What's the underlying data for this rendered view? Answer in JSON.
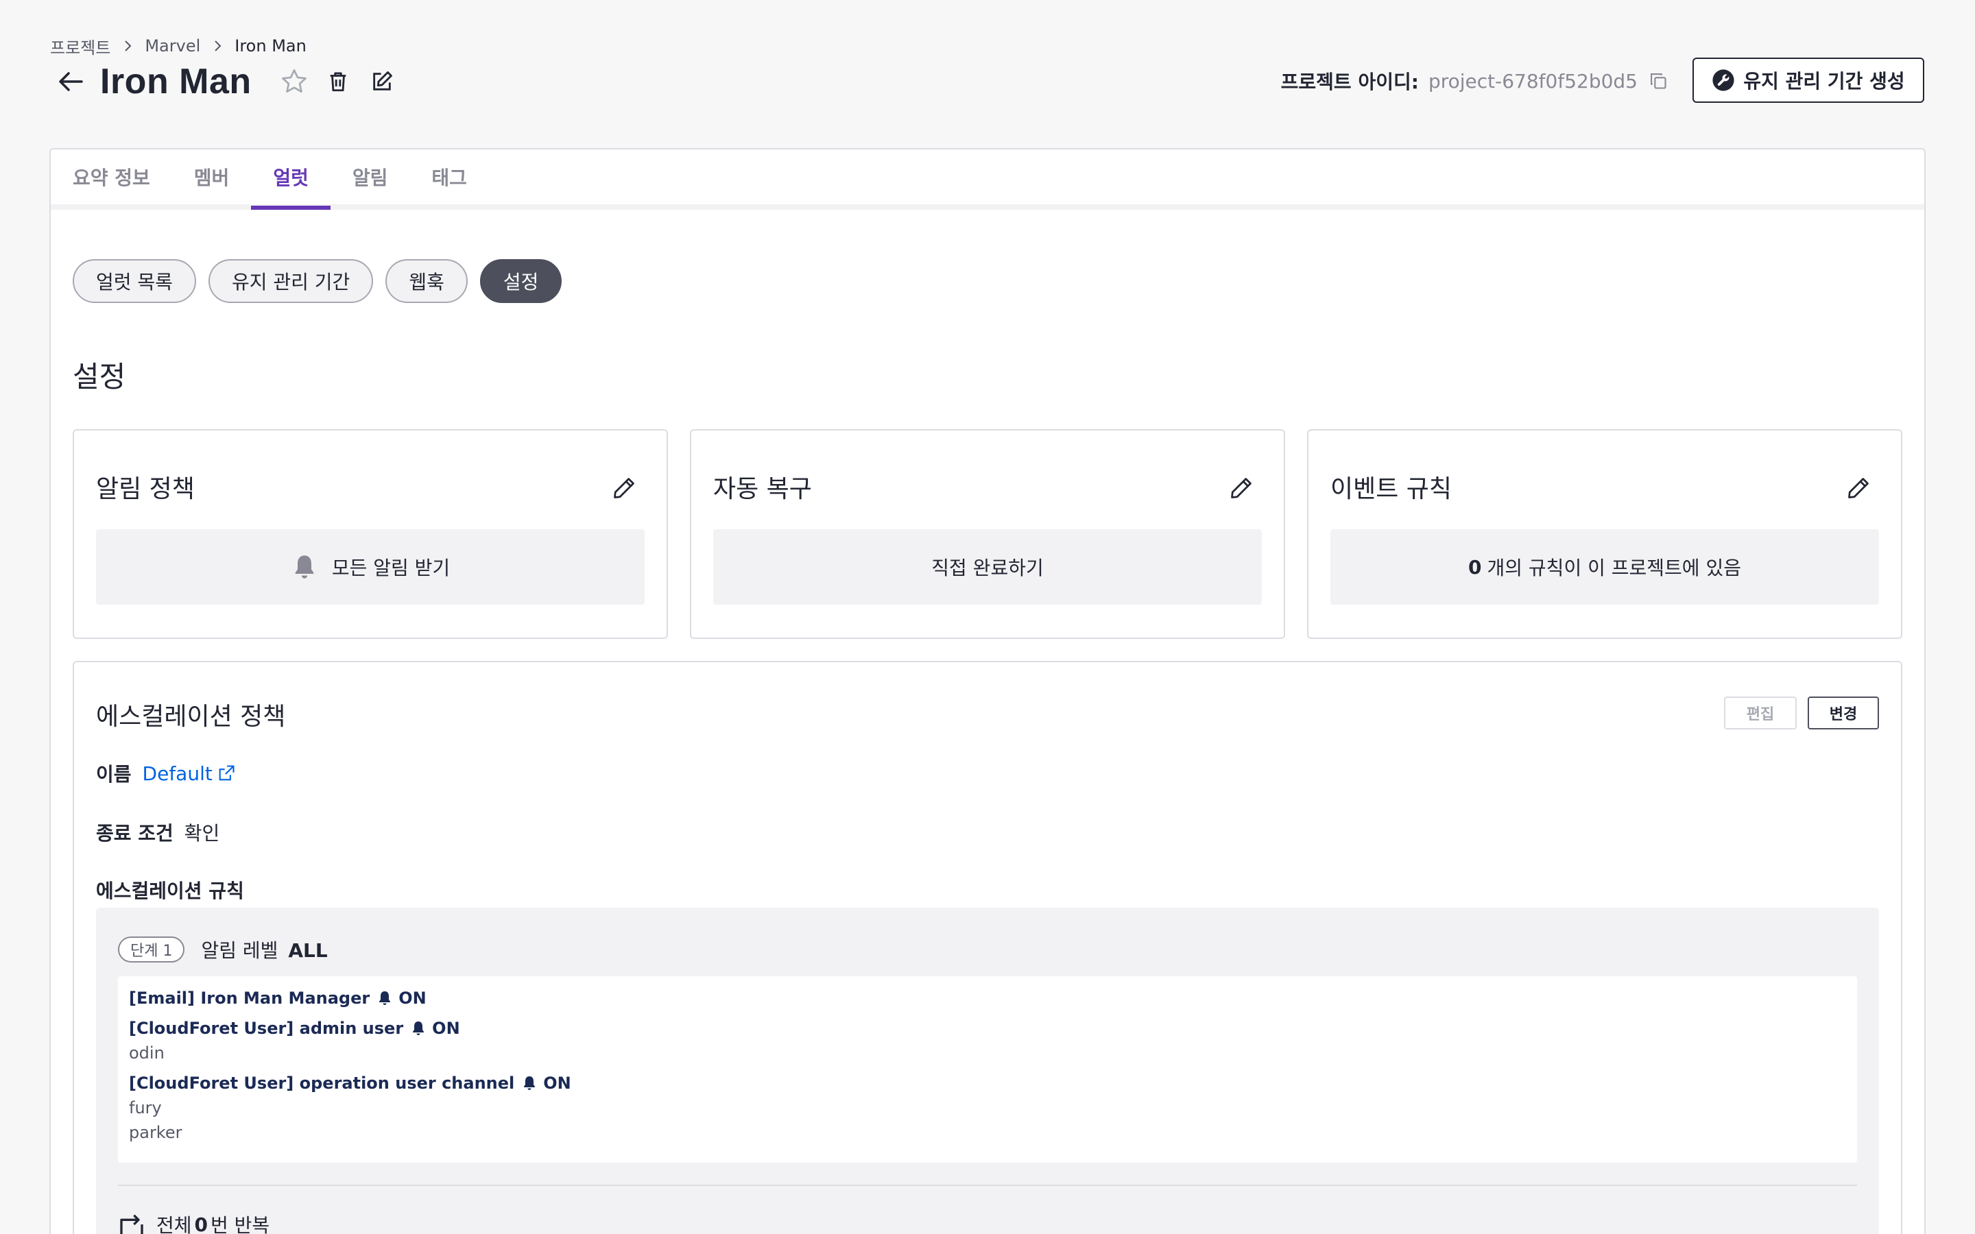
{
  "breadcrumb": [
    "프로젝트",
    "Marvel",
    "Iron Man"
  ],
  "page_title": "Iron Man",
  "project_id": {
    "label": "프로젝트 아이디:",
    "value": "project-678f0f52b0d5"
  },
  "maintenance_button": "유지 관리 기간 생성",
  "tabs": [
    "요약 정보",
    "멤버",
    "얼럿",
    "알림",
    "태그"
  ],
  "active_tab": "얼럿",
  "subtabs": [
    "얼럿 목록",
    "유지 관리 기간",
    "웹훅",
    "설정"
  ],
  "active_subtab": "설정",
  "section_title": "설정",
  "cards": {
    "notification_policy": {
      "title": "알림 정책",
      "body": "모든 알림 받기"
    },
    "auto_recovery": {
      "title": "자동 복구",
      "body": "직접 완료하기"
    },
    "event_rules": {
      "title": "이벤트 규칙",
      "count": "0",
      "body": "개의 규칙이 이 프로젝트에 있음"
    }
  },
  "escalation": {
    "title": "에스컬레이션 정책",
    "edit_label": "편집",
    "change_label": "변경",
    "name_key": "이름",
    "name_value": "Default",
    "finish_key": "종료 조건",
    "finish_value": "확인",
    "rules_label": "에스컬레이션 규칙",
    "step_badge": "단계 1",
    "level_prefix": "알림 레벨",
    "level_value": "ALL",
    "channels": [
      {
        "name": "[Email] Iron Man Manager",
        "state": "ON",
        "users": []
      },
      {
        "name": "[CloudForet User] admin user",
        "state": "ON",
        "users": [
          "odin"
        ]
      },
      {
        "name": "[CloudForet User] operation user channel",
        "state": "ON",
        "users": [
          "fury",
          "parker"
        ]
      }
    ],
    "repeat_prefix": "전체",
    "repeat_count": "0",
    "repeat_suffix": "번 반복"
  },
  "colors": {
    "accent": "#6638b6",
    "link": "#0063e0",
    "channel_text": "#1b2a55"
  }
}
